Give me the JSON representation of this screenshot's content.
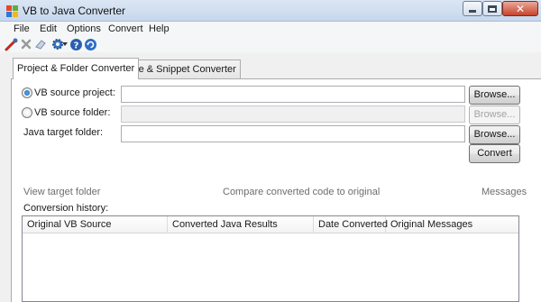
{
  "window": {
    "title": "VB to Java Converter"
  },
  "menu": [
    "File",
    "Edit",
    "Options",
    "Convert",
    "Help"
  ],
  "toolbar": {
    "icons": [
      "convert-wand-icon",
      "delete-x-icon",
      "eraser-icon",
      "settings-gear-icon",
      "help-icon",
      "refresh-icon"
    ]
  },
  "tabs": [
    "Project & Folder Converter",
    "File & Snippet Converter"
  ],
  "form": {
    "vb_project_label": "VB source project:",
    "vb_folder_label": "VB source folder:",
    "java_target_label": "Java target folder:",
    "vb_project_value": "",
    "vb_folder_value": "",
    "java_target_value": "",
    "browse_label": "Browse...",
    "convert_label": "Convert"
  },
  "links": {
    "view_target": "View target folder",
    "compare": "Compare converted code to original",
    "messages": "Messages"
  },
  "history": {
    "label": "Conversion history:",
    "columns": [
      "Original VB Source",
      "Converted Java Results",
      "Date Converted",
      "Original Messages"
    ],
    "rows": []
  },
  "colors": {
    "radio_selected": "#1c63b7",
    "titlebar": "#c6d7ec"
  }
}
